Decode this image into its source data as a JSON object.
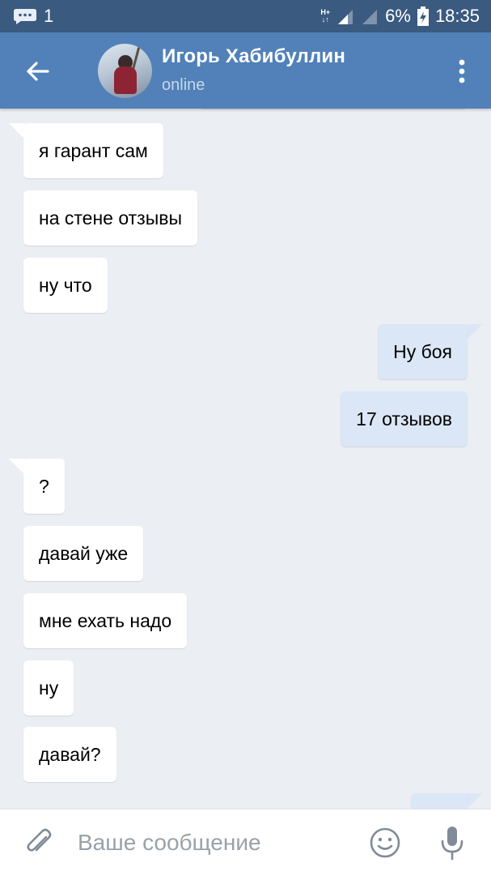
{
  "status_bar": {
    "notification_icon": "message-icon",
    "notification_count": "1",
    "network_type": "H+",
    "battery_percent": "6%",
    "time": "18:35"
  },
  "header": {
    "back_icon": "arrow-left-icon",
    "contact_name": "Игорь Хабибуллин",
    "contact_status": "online",
    "menu_icon": "more-vertical-icon"
  },
  "messages": [
    {
      "direction": "in",
      "text": "я гарант сам"
    },
    {
      "direction": "in",
      "text": "на стене отзывы"
    },
    {
      "direction": "in",
      "text": "ну что"
    },
    {
      "direction": "out",
      "text": "Ну боя"
    },
    {
      "direction": "out",
      "text": "17 отзывов"
    },
    {
      "direction": "in",
      "text": "?"
    },
    {
      "direction": "in",
      "text": "давай уже"
    },
    {
      "direction": "in",
      "text": "мне ехать надо"
    },
    {
      "direction": "in",
      "text": "ну"
    },
    {
      "direction": "in",
      "text": "давай?"
    }
  ],
  "composer": {
    "attach_icon": "paperclip-icon",
    "placeholder": "Ваше сообщение",
    "emoji_icon": "smiley-icon",
    "mic_icon": "microphone-icon"
  },
  "colors": {
    "status_bar": "#3a5a80",
    "header": "#5181b8",
    "chat_background": "#ebeef3",
    "incoming_bubble": "#ffffff",
    "outgoing_bubble": "#dbe6f6"
  }
}
